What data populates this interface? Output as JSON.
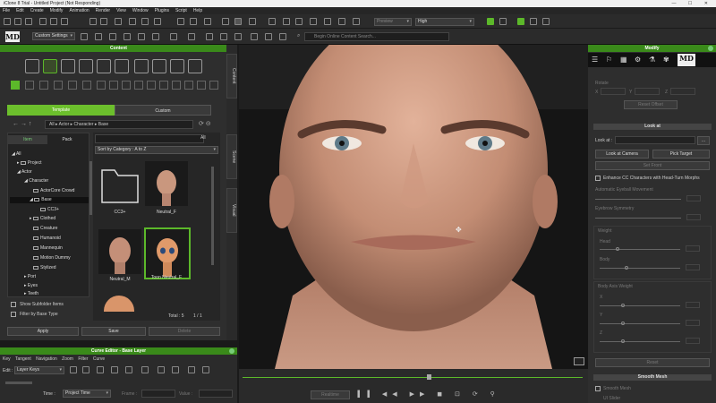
{
  "window": {
    "title": "iClone 8 Trial - Untitled Project (Not Responding)",
    "controls": "—  ☐  ✕"
  },
  "menu": [
    "File",
    "Edit",
    "Create",
    "Modify",
    "Animation",
    "Render",
    "View",
    "Window",
    "Plugins",
    "Script",
    "Help"
  ],
  "toolbar": {
    "preview_combo": "Preview",
    "quality_combo": "High",
    "settings_combo": "Custom Settings",
    "search_placeholder": "Begin Online Content Search..."
  },
  "content": {
    "title": "Content",
    "tabs": {
      "template": "Template",
      "custom": "Custom"
    },
    "breadcrumb": "All ▸ Actor ▸ Character ▸ Base",
    "subtabs": {
      "item": "Item",
      "pack": "Pack"
    },
    "tree": [
      "All",
      "Project",
      "Actor",
      "Character",
      "ActorCore Crowd",
      "Base",
      "CC3+",
      "Clothed",
      "Creature",
      "Humanoid",
      "Mannequin",
      "Motion Dummy",
      "Stylized",
      "Port",
      "Eyes",
      "Teeth"
    ],
    "search_label": "All",
    "sort": "Sort by Category : A to Z",
    "items": [
      "CC3+",
      "Neutral_F",
      "Neutral_M",
      "Toon Neutral_F"
    ],
    "show_subfolder": "Show Subfolder Items",
    "filter_base": "Filter by Base Type",
    "total": "Total : 5",
    "pager": "1 / 1",
    "apply": "Apply",
    "save": "Save",
    "delete": "Delete",
    "side_tabs": [
      "Content",
      "Scene",
      "Visual"
    ]
  },
  "curve": {
    "title": "Curve Editor - Base Layer",
    "menu": [
      "Key",
      "Tangent",
      "Navigation",
      "Zoom",
      "Filter",
      "Curve"
    ],
    "edit_label": "Edit :",
    "layer_combo": "Layer Keys",
    "time_label": "Time :",
    "time_combo": "Project Time",
    "frame_label": "Frame :",
    "value_label": "Value :"
  },
  "timeline": {
    "realtime": "Realtime"
  },
  "modify": {
    "title": "Modify",
    "rotate": "Rotate",
    "xyz": [
      "X",
      "Y",
      "Z"
    ],
    "reset_offset": "Reset Offset",
    "look_at_section": "Look at",
    "look_at_label": "Look at :",
    "look_at_camera": "Look at Camera",
    "pick_target": "Pick Target",
    "set_front": "Set Front",
    "enhance": "Enhance CC Characters with Head-Turn Morphs",
    "eyeball": "Automatic Eyeball Movement",
    "eyebrow": "Eyebrow Symmetry",
    "weight": "Weight",
    "head": "Head",
    "body": "Body",
    "body_axis": "Body Axis Weight",
    "reset": "Reset",
    "smooth_mesh": "Smooth Mesh",
    "smooth_label": "Smooth Mesh",
    "ui_label": "UI Slider"
  },
  "colors": {
    "accent": "#5cb82a",
    "panel_head": "#3a8a1a"
  }
}
